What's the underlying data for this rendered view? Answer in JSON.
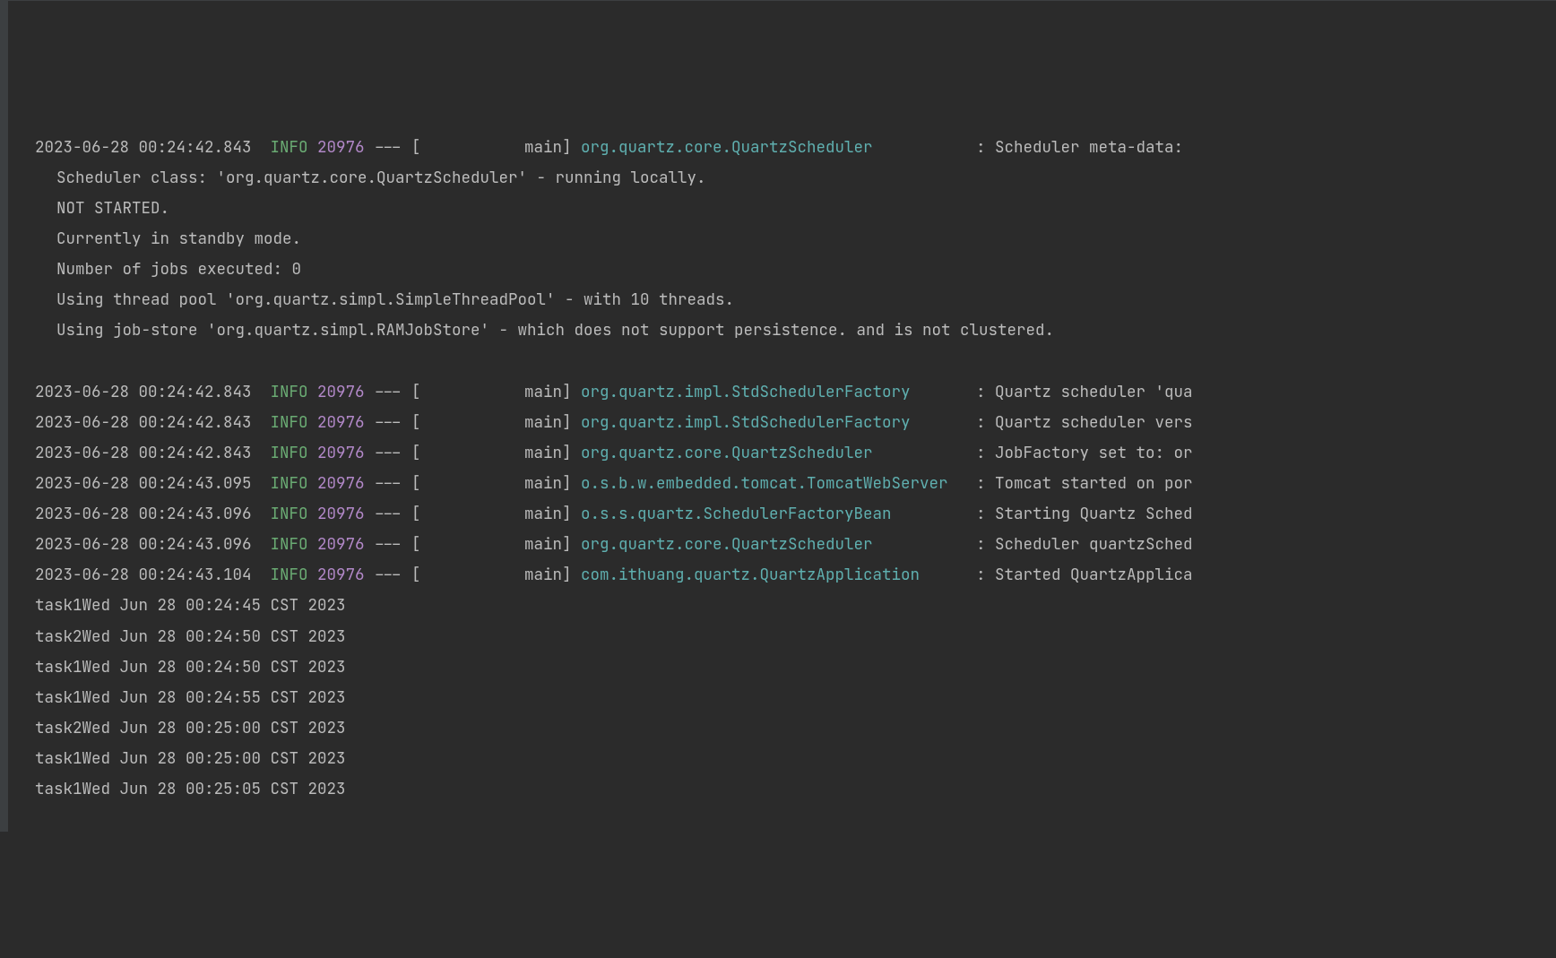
{
  "colors": {
    "bg": "#2b2b2b",
    "text": "#bbbbbb",
    "info": "#6aab73",
    "pid": "#b288c8",
    "logger": "#5fafaf"
  },
  "gutter_left": true,
  "entries": [
    {
      "type": "log",
      "timestamp": "2023-06-28 00:24:42.843",
      "level": "INFO",
      "pid": "20976",
      "dashes": "---",
      "bracket_open": "[",
      "thread": "           main]",
      "logger": "org.quartz.core.QuartzScheduler",
      "colon": ":",
      "message": "Scheduler meta-data:"
    },
    {
      "type": "plain",
      "indent": true,
      "text": "Scheduler class: 'org.quartz.core.QuartzScheduler' - running locally."
    },
    {
      "type": "plain",
      "indent": true,
      "text": "NOT STARTED."
    },
    {
      "type": "plain",
      "indent": true,
      "text": "Currently in standby mode."
    },
    {
      "type": "plain",
      "indent": true,
      "text": "Number of jobs executed: 0"
    },
    {
      "type": "plain",
      "indent": true,
      "text": "Using thread pool 'org.quartz.simpl.SimpleThreadPool' - with 10 threads."
    },
    {
      "type": "plain",
      "indent": true,
      "text": "Using job-store 'org.quartz.simpl.RAMJobStore' - which does not support persistence. and is not clustered."
    },
    {
      "type": "blank"
    },
    {
      "type": "log",
      "timestamp": "2023-06-28 00:24:42.843",
      "level": "INFO",
      "pid": "20976",
      "dashes": "---",
      "bracket_open": "[",
      "thread": "           main]",
      "logger": "org.quartz.impl.StdSchedulerFactory",
      "colon": ":",
      "message": "Quartz scheduler 'qua"
    },
    {
      "type": "log",
      "timestamp": "2023-06-28 00:24:42.843",
      "level": "INFO",
      "pid": "20976",
      "dashes": "---",
      "bracket_open": "[",
      "thread": "           main]",
      "logger": "org.quartz.impl.StdSchedulerFactory",
      "colon": ":",
      "message": "Quartz scheduler vers"
    },
    {
      "type": "log",
      "timestamp": "2023-06-28 00:24:42.843",
      "level": "INFO",
      "pid": "20976",
      "dashes": "---",
      "bracket_open": "[",
      "thread": "           main]",
      "logger": "org.quartz.core.QuartzScheduler",
      "colon": ":",
      "message": "JobFactory set to: or"
    },
    {
      "type": "log",
      "timestamp": "2023-06-28 00:24:43.095",
      "level": "INFO",
      "pid": "20976",
      "dashes": "---",
      "bracket_open": "[",
      "thread": "           main]",
      "logger": "o.s.b.w.embedded.tomcat.TomcatWebServer",
      "colon": ":",
      "message": "Tomcat started on por"
    },
    {
      "type": "log",
      "timestamp": "2023-06-28 00:24:43.096",
      "level": "INFO",
      "pid": "20976",
      "dashes": "---",
      "bracket_open": "[",
      "thread": "           main]",
      "logger": "o.s.s.quartz.SchedulerFactoryBean",
      "colon": ":",
      "message": "Starting Quartz Sched"
    },
    {
      "type": "log",
      "timestamp": "2023-06-28 00:24:43.096",
      "level": "INFO",
      "pid": "20976",
      "dashes": "---",
      "bracket_open": "[",
      "thread": "           main]",
      "logger": "org.quartz.core.QuartzScheduler",
      "colon": ":",
      "message": "Scheduler quartzSched"
    },
    {
      "type": "log",
      "timestamp": "2023-06-28 00:24:43.104",
      "level": "INFO",
      "pid": "20976",
      "dashes": "---",
      "bracket_open": "[",
      "thread": "           main]",
      "logger": "com.ithuang.quartz.QuartzApplication",
      "colon": ":",
      "message": "Started QuartzApplica"
    },
    {
      "type": "plain",
      "indent": false,
      "text": "task1Wed Jun 28 00:24:45 CST 2023"
    },
    {
      "type": "plain",
      "indent": false,
      "text": "task2Wed Jun 28 00:24:50 CST 2023"
    },
    {
      "type": "plain",
      "indent": false,
      "text": "task1Wed Jun 28 00:24:50 CST 2023"
    },
    {
      "type": "plain",
      "indent": false,
      "text": "task1Wed Jun 28 00:24:55 CST 2023"
    },
    {
      "type": "plain",
      "indent": false,
      "text": "task2Wed Jun 28 00:25:00 CST 2023"
    },
    {
      "type": "plain",
      "indent": false,
      "text": "task1Wed Jun 28 00:25:00 CST 2023"
    },
    {
      "type": "plain",
      "indent": false,
      "text": "task1Wed Jun 28 00:25:05 CST 2023"
    }
  ],
  "layout": {
    "logger_col_width": 41,
    "sep1": "  ",
    "sep_level_pid": " ",
    "sep_pid_dash": " ",
    "sep_dash_bracket": " ",
    "sep_thread_logger": " ",
    "sep_logger_colon": " ",
    "sep_colon_msg": " "
  }
}
